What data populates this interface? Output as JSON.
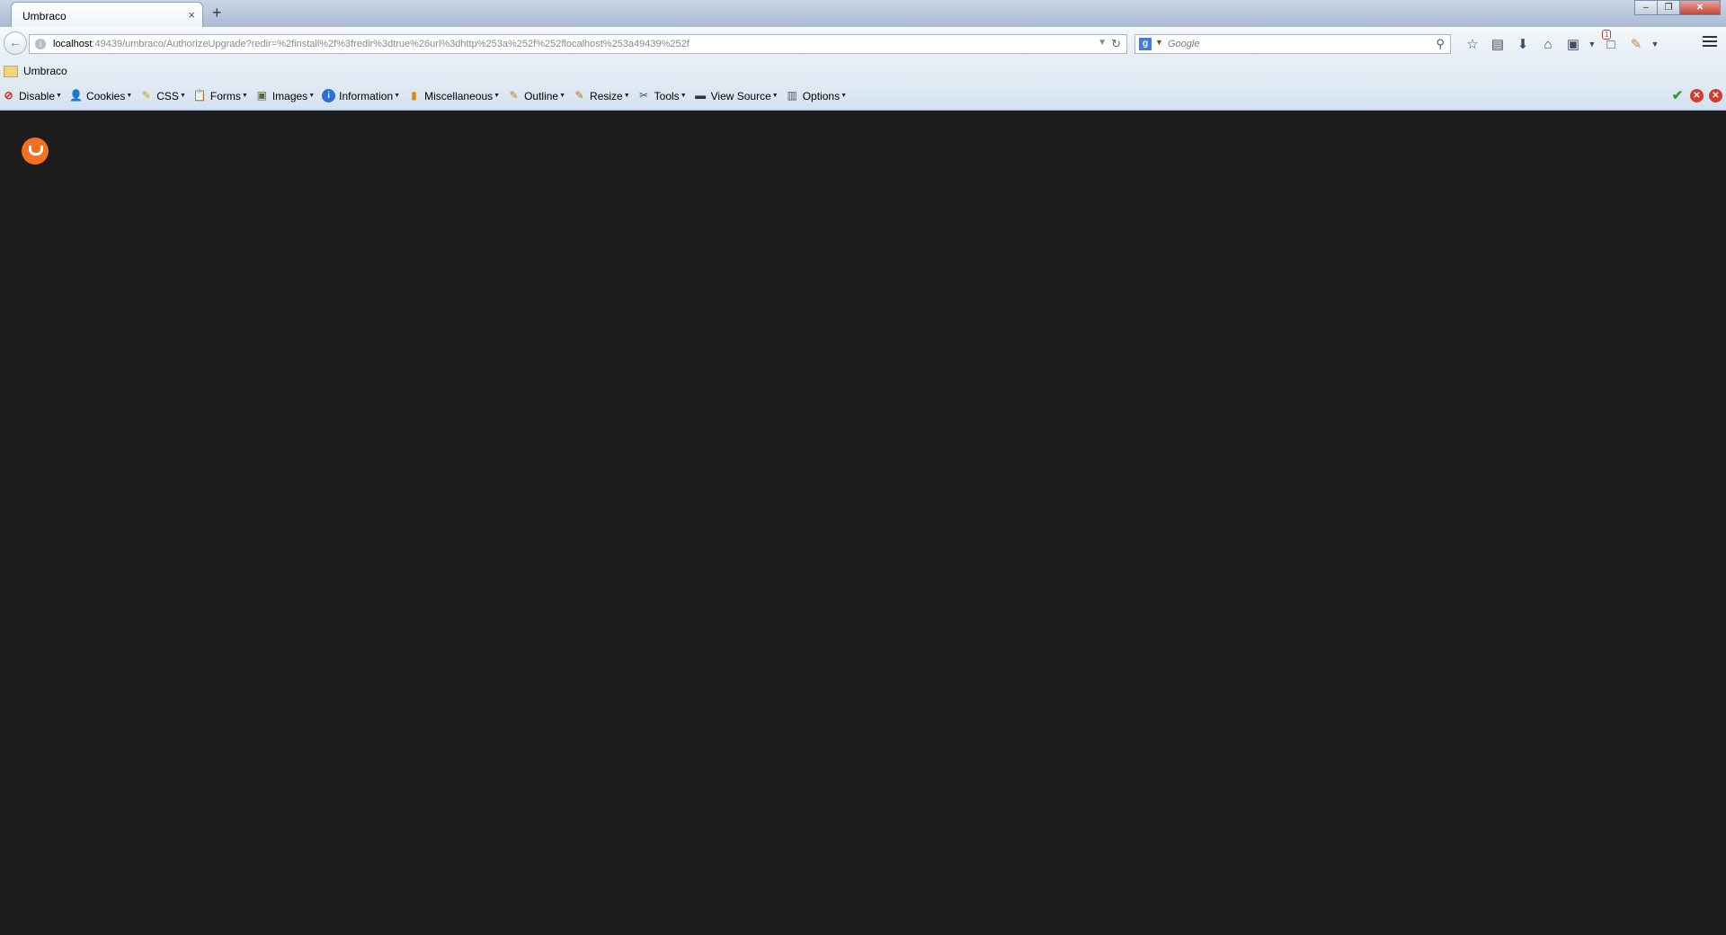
{
  "browser": {
    "tab": {
      "title": "Umbraco",
      "close_glyph": "×"
    },
    "new_tab_glyph": "+",
    "window_controls": {
      "minimize": "–",
      "maximize": "❐",
      "close": "✕"
    },
    "address": {
      "host": "localhost",
      "path": ":49439/umbraco/AuthorizeUpgrade?redir=%2finstall%2f%3fredir%3dtrue%26url%3dhttp%253a%252f%252flocalhost%253a49439%252f"
    },
    "search": {
      "engine_letter": "g",
      "placeholder": "Google"
    },
    "nav_icons": [
      "star-icon",
      "reading-list-icon",
      "download-icon",
      "home-icon",
      "screenshot-icon",
      "dropdown-icon",
      "notifications-icon",
      "extension-icon",
      "dropdown-icon"
    ],
    "notification_count": "1"
  },
  "bookmarks": [
    {
      "label": "Umbraco",
      "icon": "folder-icon"
    }
  ],
  "devtoolbar": {
    "items": [
      {
        "label": "Disable",
        "icon": "disable-icon"
      },
      {
        "label": "Cookies",
        "icon": "cookies-icon"
      },
      {
        "label": "CSS",
        "icon": "css-icon"
      },
      {
        "label": "Forms",
        "icon": "forms-icon"
      },
      {
        "label": "Images",
        "icon": "images-icon"
      },
      {
        "label": "Information",
        "icon": "information-icon"
      },
      {
        "label": "Miscellaneous",
        "icon": "miscellaneous-icon"
      },
      {
        "label": "Outline",
        "icon": "outline-icon"
      },
      {
        "label": "Resize",
        "icon": "resize-icon"
      },
      {
        "label": "Tools",
        "icon": "tools-icon"
      },
      {
        "label": "View Source",
        "icon": "view-source-icon"
      },
      {
        "label": "Options",
        "icon": "options-icon"
      }
    ],
    "status_icons": [
      "check-icon",
      "error-icon",
      "error-icon"
    ]
  },
  "page": {
    "background": "#1d1d1d",
    "logo_color": "#f36f21"
  }
}
